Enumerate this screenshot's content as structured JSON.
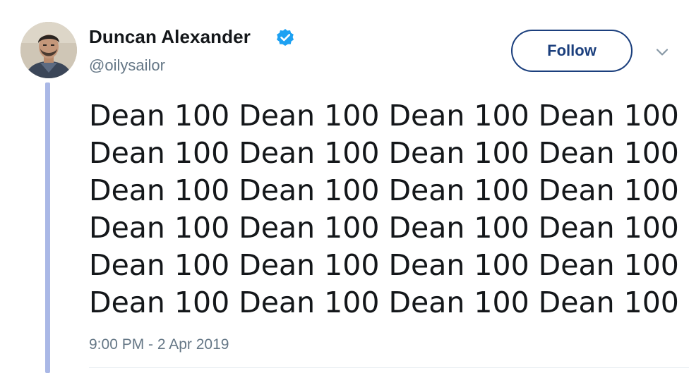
{
  "author": {
    "display_name": "Duncan Alexander",
    "handle": "@oilysailor",
    "verified": true,
    "avatar_icon": "profile-photo"
  },
  "actions": {
    "follow_label": "Follow",
    "menu_icon": "chevron-down-icon"
  },
  "tweet": {
    "lines": [
      "Dean 100 Dean 100 Dean 100 Dean 100",
      "Dean 100 Dean 100 Dean 100 Dean 100",
      "Dean 100 Dean 100 Dean 100 Dean 100",
      "Dean 100 Dean 100 Dean 100 Dean 100",
      "Dean 100 Dean 100 Dean 100 Dean 100",
      "Dean 100 Dean 100 Dean 100 Dean 100"
    ],
    "timestamp": "9:00 PM - 2 Apr 2019"
  },
  "colors": {
    "verified_blue": "#1da1f2",
    "follow_border": "#1b3f7d",
    "thread_line": "#aab8e6",
    "secondary_text": "#657786"
  }
}
